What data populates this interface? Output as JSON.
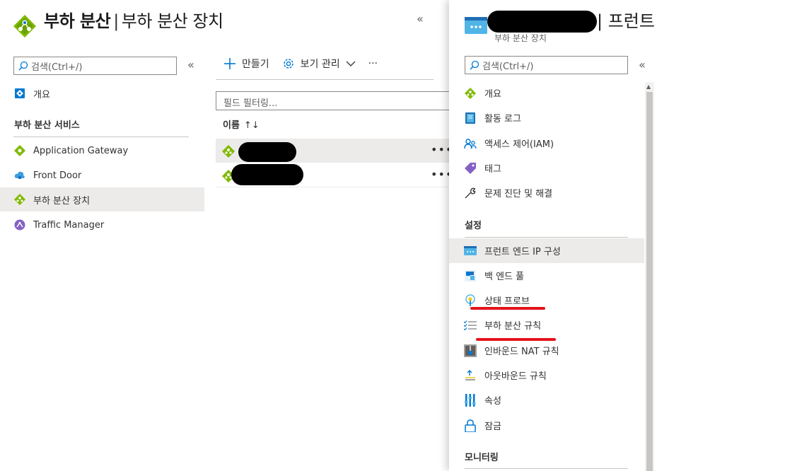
{
  "header": {
    "title_bold": "부하 분산",
    "separator": "|",
    "title_rest": "부하 분산 장치",
    "collapse": "«"
  },
  "left_nav": {
    "search_placeholder": "검색(Ctrl+/)",
    "collapse": "«",
    "overview": "개요",
    "group_label": "부하 분산 서비스",
    "items": [
      {
        "label": "Application Gateway",
        "icon": "application-gateway-icon"
      },
      {
        "label": "Front Door",
        "icon": "front-door-icon"
      },
      {
        "label": "부하 분산 장치",
        "icon": "load-balancer-icon",
        "selected": true
      },
      {
        "label": "Traffic Manager",
        "icon": "traffic-manager-icon"
      }
    ]
  },
  "list": {
    "toolbar": {
      "create": "만들기",
      "manage_view": "보기 관리",
      "more": "···"
    },
    "filter_placeholder": "필드 필터링...",
    "column_name": "이름",
    "sort_arrow": "↑↓",
    "row_more": "•••",
    "rows": 2
  },
  "blade": {
    "title_suffix": "| 프런트",
    "subtitle": "부하 분산 장치",
    "search_placeholder": "검색(Ctrl+/)",
    "collapse": "«",
    "items": [
      {
        "label": "개요",
        "icon": "load-balancer-icon"
      },
      {
        "label": "활동 로그",
        "icon": "activity-log-icon"
      },
      {
        "label": "액세스 제어(IAM)",
        "icon": "iam-icon"
      },
      {
        "label": "태그",
        "icon": "tag-icon"
      },
      {
        "label": "문제 진단 및 해결",
        "icon": "wrench-icon"
      }
    ],
    "settings_label": "설정",
    "settings_items": [
      {
        "label": "프런트 엔드 IP 구성",
        "icon": "frontend-ip-icon",
        "selected": true
      },
      {
        "label": "백 엔드 풀",
        "icon": "backend-pool-icon"
      },
      {
        "label": "상태 프로브",
        "icon": "health-probe-icon"
      },
      {
        "label": "부하 분산 규칙",
        "icon": "lb-rules-icon"
      },
      {
        "label": "인바운드 NAT 규칙",
        "icon": "inbound-nat-icon"
      },
      {
        "label": "아웃바운드 규칙",
        "icon": "outbound-rules-icon"
      },
      {
        "label": "속성",
        "icon": "properties-icon"
      },
      {
        "label": "잠금",
        "icon": "lock-icon"
      }
    ],
    "monitoring_label": "모니터링"
  },
  "colors": {
    "accent": "#0078d4",
    "lb_green": "#5ea0ef",
    "annotation_red": "#e3141b",
    "selected_bg": "#edebe9"
  }
}
